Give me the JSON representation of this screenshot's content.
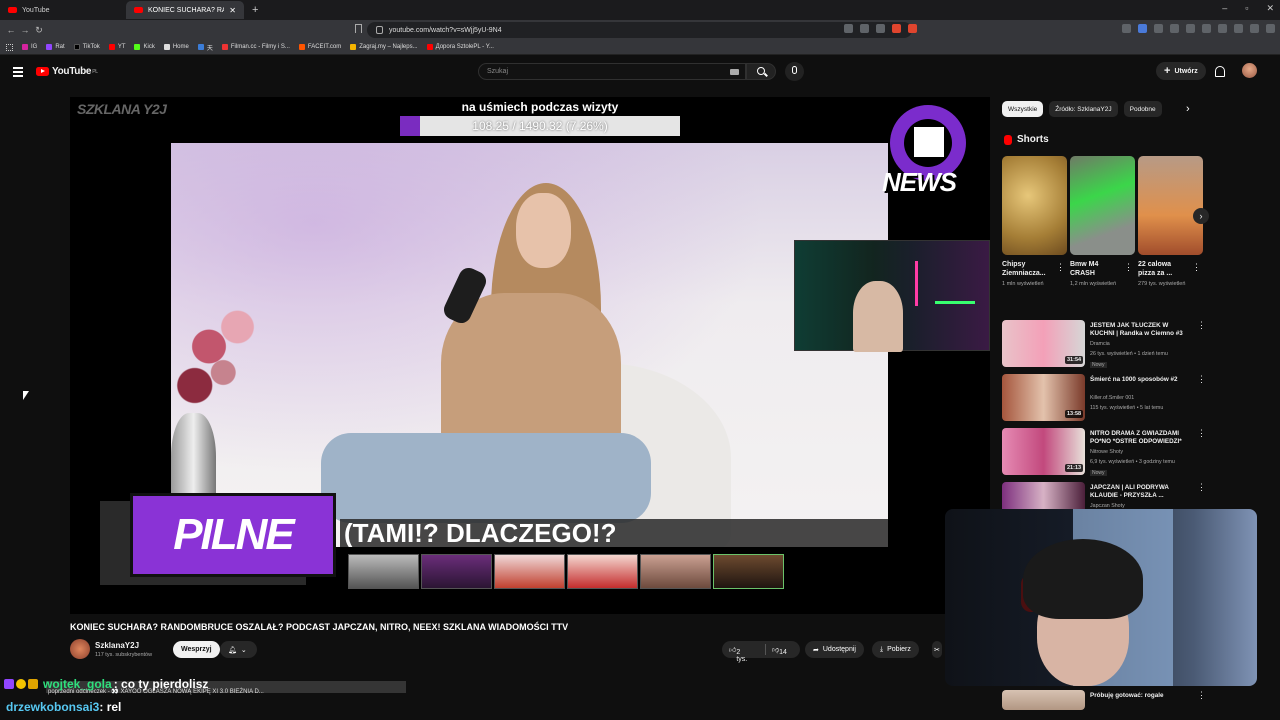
{
  "browser": {
    "tabs": [
      {
        "label": "YouTube",
        "active": false
      },
      {
        "label": "KONIEC SUCHARA? RANDO...",
        "active": true
      }
    ],
    "url": "youtube.com/watch?v=sWjj5yU-9N4",
    "bookmarks": [
      "IG",
      "Rat",
      "TikTok",
      "YT",
      "Kick",
      "Home",
      "天",
      "Filman.cc - Filmy i S...",
      "FACEIT.com",
      "Zagraj.my – Najleps...",
      "Доpora SztolePL - Y..."
    ]
  },
  "header": {
    "logo_text": "YouTube",
    "logo_region": "PL",
    "search_placeholder": "Szukaj",
    "create_label": "Utwórz"
  },
  "player": {
    "watermark": "SZKLANA Y2J",
    "goal_title": "na uśmiech podczas wizyty",
    "goal_progress_text": "108.25 / 1490.32 (7.26%)",
    "goal_fraction": 0.0726,
    "news_logo": "NEWS",
    "pilne": "PILNE",
    "ticker": "(TAMI!? DLACZEGO!?"
  },
  "video": {
    "title": "KONIEC SUCHARA? RANDOMBRUCE OSZALAŁ? PODCAST JAPCZAN, NITRO, NEEX! SZKLANA WIADOMOŚCI TTV",
    "channel": "SzklanaY2J",
    "subscribers": "117 tys. subskrybentów",
    "join_label": "Wesprzyj",
    "likes": "2 tys.",
    "dislikes": "14",
    "share_label": "Udostępnij",
    "download_label": "Pobierz"
  },
  "sidebar": {
    "chips": [
      "Wszystkie",
      "Źródło: SzklanaY2J",
      "Podobne"
    ],
    "shorts_heading": "Shorts",
    "shorts": [
      {
        "title": "Chipsy Ziemniacza...",
        "views": "1 mln wyświetleń"
      },
      {
        "title": "Bmw M4 CRASH",
        "views": "1,2 mln wyświetleń"
      },
      {
        "title": "22 calowa pizza za ...",
        "views": "279 tys. wyświetleń"
      }
    ],
    "recommendations": [
      {
        "title": "JESTEM JAK TŁUCZEK W KUCHNI | Randka w Ciemno #3",
        "channel": "Dramcia",
        "views": "26 tys. wyświetleń • 1 dzień temu",
        "badge": "Nowy",
        "duration": "31:54"
      },
      {
        "title": "Śmierć na 1000 sposobów #2",
        "channel": "Killer.of.Smiler 001",
        "views": "115 tys. wyświetleń • 5 lat temu",
        "badge": "",
        "duration": "13:58"
      },
      {
        "title": "NITRO DRAMA Z GWIAZDAMI PO*NO *OSTRE ODPOWIEDZI*",
        "channel": "Nitrowe Shoty",
        "views": "6,9 tys. wyświetleń • 3 godziny temu",
        "badge": "Nowy",
        "duration": "21:13"
      },
      {
        "title": "JAPCZAN | ALI PODRYWA KLAUDIE - PRZYSZŁA ...",
        "channel": "Japczan Shoty",
        "views": "",
        "badge": "",
        "duration": ""
      }
    ],
    "last_rec_title": "Próbuję gotować: rogale"
  },
  "chat": {
    "reply_line": "poprzedni odcineczek - 👀 XAYOO OGŁASZA NOWĄ EKIPĘ XI 3.0  BIEŻNIA D...",
    "messages": [
      {
        "user": "wojtek_gola",
        "text": ": co ty pierdolisz"
      },
      {
        "user": "drzewkobonsai3",
        "text": ": rel"
      }
    ]
  }
}
